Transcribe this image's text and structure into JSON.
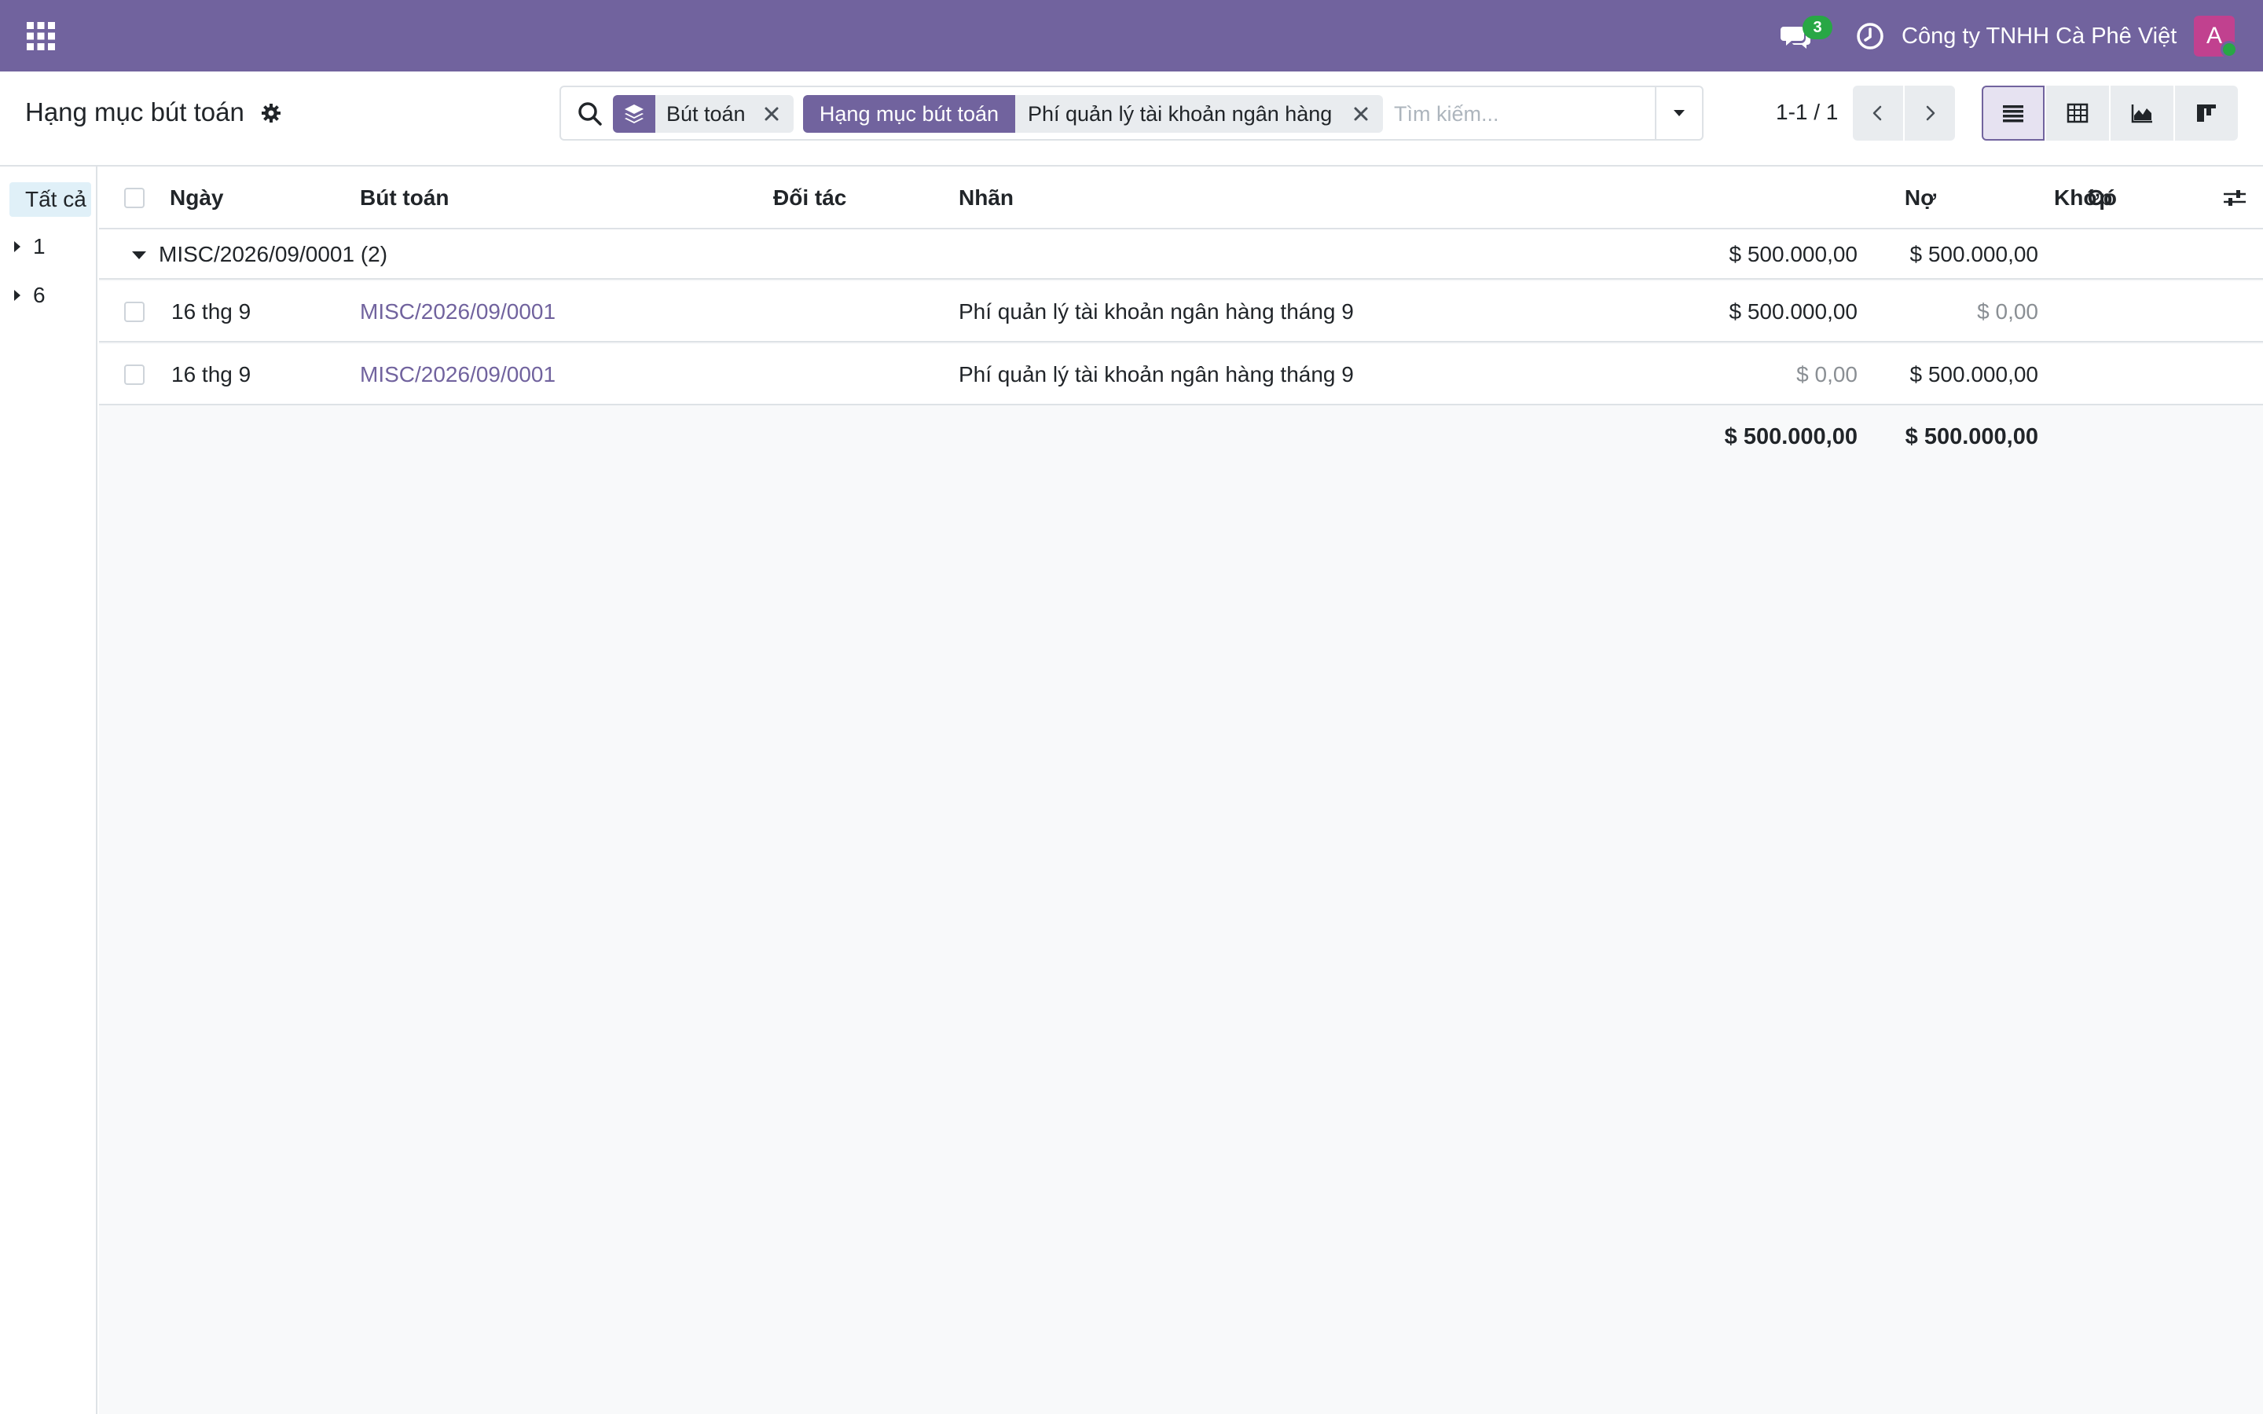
{
  "navbar": {
    "messages_count": "3",
    "company": "Công ty TNHH Cà Phê Việt",
    "avatar_initial": "A"
  },
  "control_panel": {
    "title": "Hạng mục bút toán",
    "search": {
      "facets": [
        {
          "type": "groupby",
          "icon": "layers-icon",
          "values": "Bút toán"
        },
        {
          "type": "filter",
          "label": "Hạng mục bút toán",
          "values": "Phí quản lý tài khoản ngân hàng"
        }
      ],
      "placeholder": "Tìm kiếm...",
      "value": ""
    },
    "pager": "1-1 / 1",
    "views": [
      "list",
      "pivot",
      "graph",
      "kanban"
    ],
    "active_view": "list"
  },
  "side_panel": {
    "all_label": "Tất cả",
    "items": [
      "1",
      "6"
    ]
  },
  "list": {
    "columns": {
      "date": "Ngày",
      "move": "Bút toán",
      "partner": "Đối tác",
      "label": "Nhãn",
      "debit": "Nợ",
      "credit": "Có",
      "matching": "Khớp"
    },
    "group": {
      "name": "MISC/2026/09/0001 (2)",
      "debit": "$ 500.000,00",
      "credit": "$ 500.000,00"
    },
    "rows": [
      {
        "date": "16 thg 9",
        "move": "MISC/2026/09/0001",
        "partner": "",
        "label": "Phí quản lý tài khoản ngân hàng tháng 9",
        "debit": "$ 500.000,00",
        "credit": "$ 0,00",
        "matching": ""
      },
      {
        "date": "16 thg 9",
        "move": "MISC/2026/09/0001",
        "partner": "",
        "label": "Phí quản lý tài khoản ngân hàng tháng 9",
        "debit": "$ 0,00",
        "credit": "$ 500.000,00",
        "matching": ""
      }
    ],
    "totals": {
      "debit": "$ 500.000,00",
      "credit": "$ 500.000,00"
    }
  },
  "colors": {
    "brand": "#71639e",
    "badge": "#28a745",
    "avatar": "#c1418f"
  }
}
